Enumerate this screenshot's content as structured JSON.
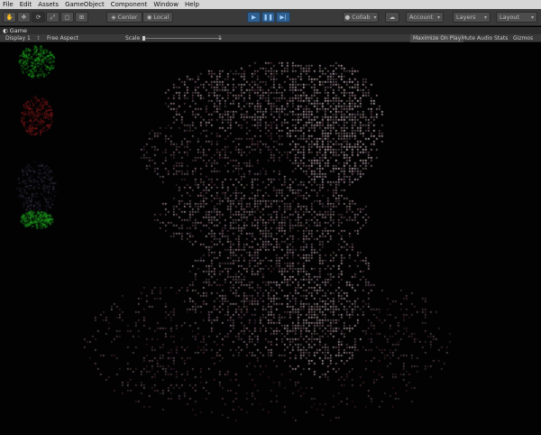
{
  "menu": [
    "File",
    "Edit",
    "Assets",
    "GameObject",
    "Component",
    "Window",
    "Help"
  ],
  "toolbar": {
    "tools": [
      {
        "name": "hand-tool-button",
        "icon": "hand-icon",
        "glyph": "✋"
      },
      {
        "name": "move-tool-button",
        "icon": "move-icon",
        "glyph": "✥"
      },
      {
        "name": "rotate-tool-button",
        "icon": "rotate-icon",
        "glyph": "⟳"
      },
      {
        "name": "scale-tool-button",
        "icon": "scale-icon",
        "glyph": "⤢"
      },
      {
        "name": "rect-tool-button",
        "icon": "rect-icon",
        "glyph": "▢"
      },
      {
        "name": "transform-tool-button",
        "icon": "transform-icon",
        "glyph": "⊞"
      }
    ],
    "center_label": "Center",
    "local_label": "Local",
    "play_icon": "play-icon",
    "pause_icon": "pause-icon",
    "step_icon": "step-icon",
    "collab_label": "Collab",
    "cloud_icon": "cloud-icon",
    "account_label": "Account",
    "layers_label": "Layers",
    "layout_label": "Layout"
  },
  "game": {
    "tab_label": "Game",
    "display_label": "Display 1",
    "aspect_label": "Free Aspect",
    "scale_label": "Scale",
    "scale_value": "1",
    "maximize_label": "Maximize On Play",
    "mute_label": "Mute Audio",
    "stats_label": "Stats",
    "gizmos_label": "Gizmos"
  },
  "colors": {
    "accent": "#2f5f8f",
    "menubar": "#d6d6d6",
    "toolbar": "#3a3a3a"
  }
}
